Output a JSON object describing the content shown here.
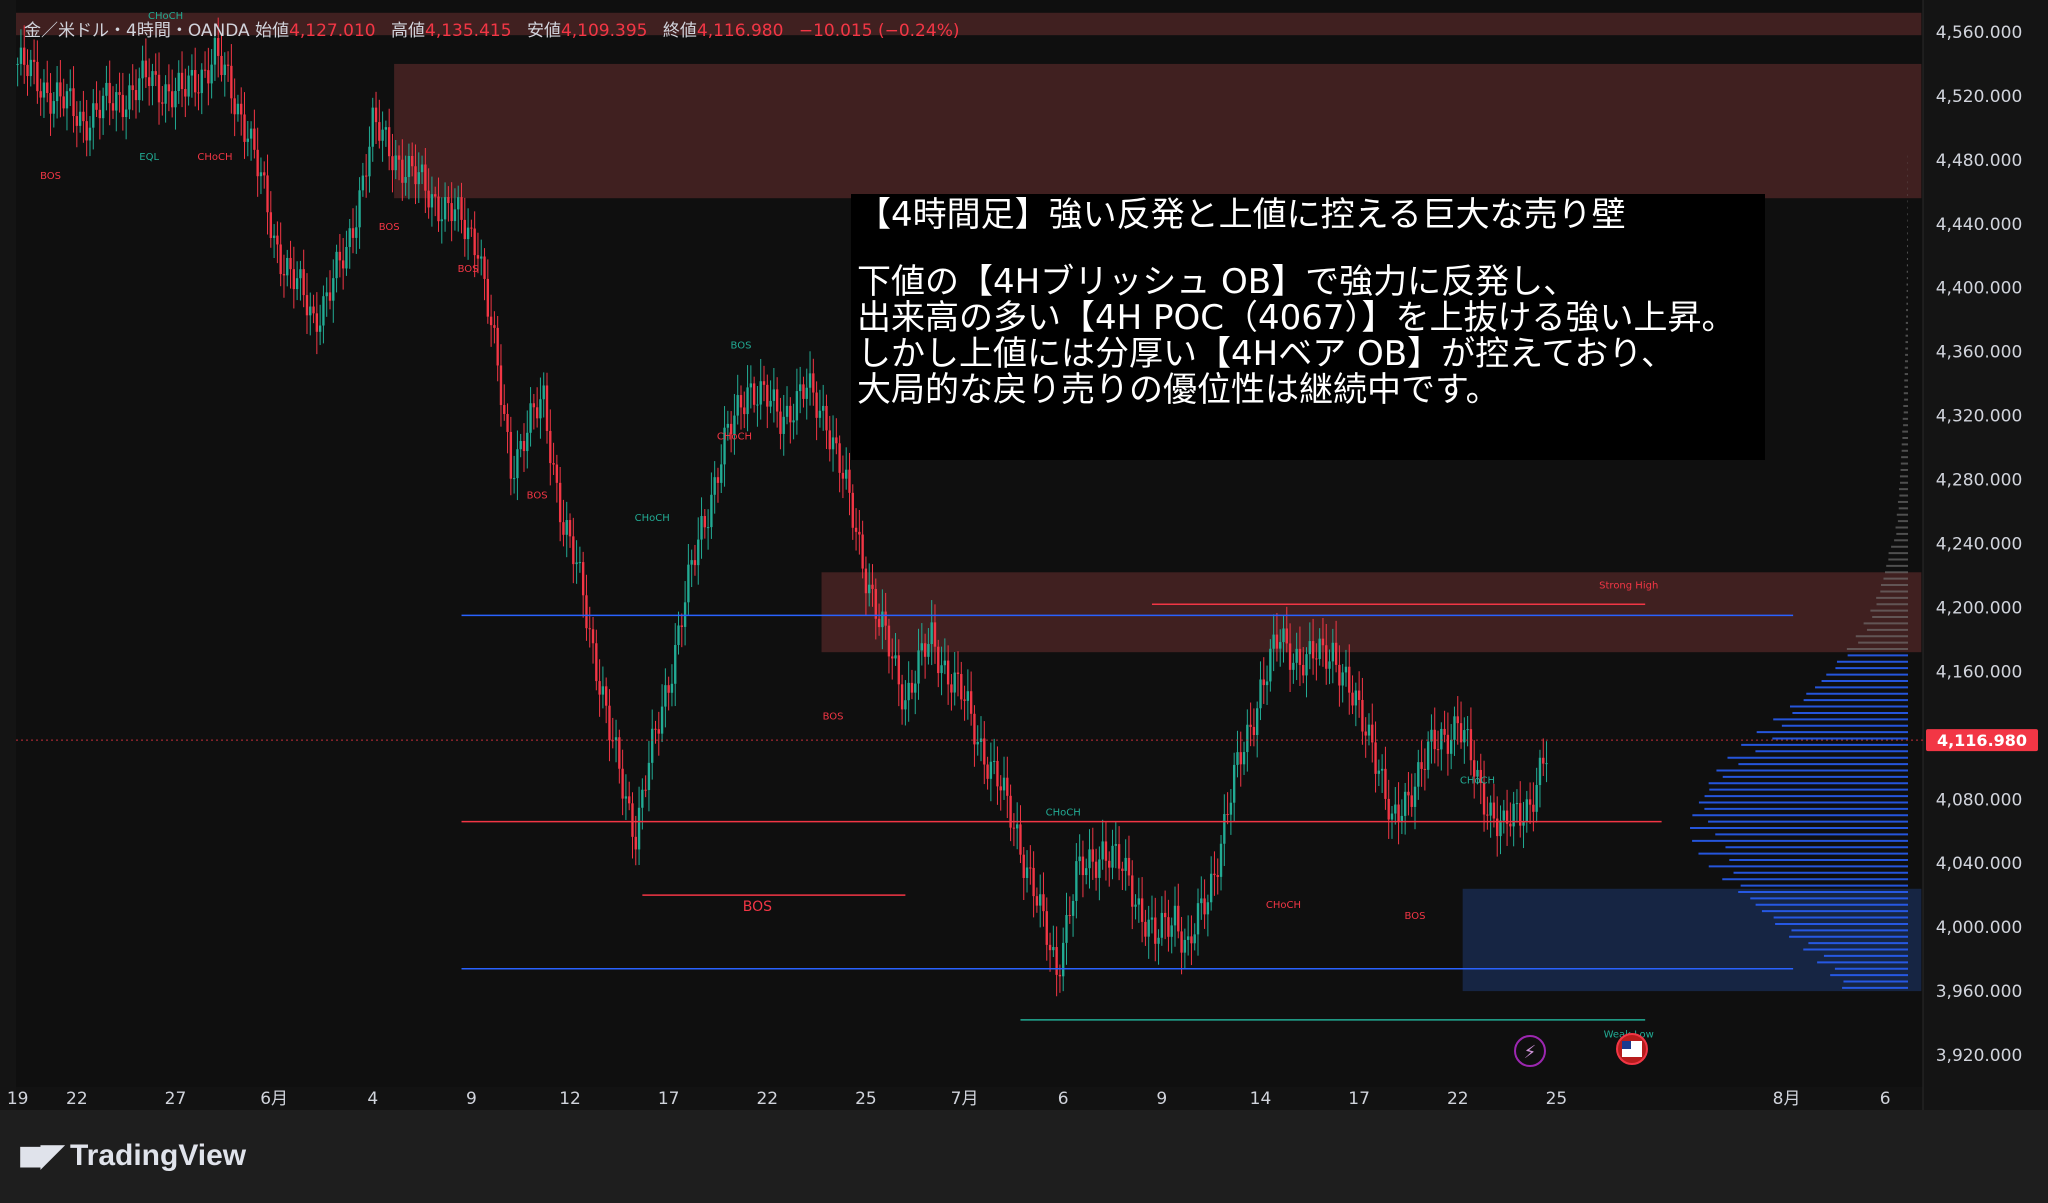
{
  "colors": {
    "up": "#22ab94",
    "down": "#f23645",
    "blue": "#2962ff",
    "bg": "#141414",
    "bear_zone": "#5a2a2a",
    "bull_zone": "#1a2d55",
    "price_label_bg": "#f23645"
  },
  "legend": {
    "symbol": "金／米ドル・4時間・OANDA",
    "open_label": "始値",
    "open": "4,127.010",
    "high_label": "高値",
    "high": "4,135.415",
    "low_label": "安値",
    "low": "4,109.395",
    "close_label": "終値",
    "close": "4,116.980",
    "change": "−10.015 (−0.24%)"
  },
  "annotation": {
    "title": "【4時間足】強い反発と上値に控える巨大な売り壁",
    "body": "下値の【4Hブリッシュ OB】で強力に反発し、\n出来高の多い【4H POC（4067）】を上抜ける強い上昇。\nしかし上値には分厚い【4Hベア OB】が控えており、\n大局的な戻り売りの優位性は継続中です。"
  },
  "footer": {
    "brand": "TradingView"
  },
  "chart_data": {
    "type": "candlestick",
    "title": "",
    "xlabel": "",
    "ylabel": "",
    "ylim": [
      3900,
      4580
    ],
    "y_ticks": [
      "4,560.000",
      "4,520.000",
      "4,480.000",
      "4,440.000",
      "4,400.000",
      "4,360.000",
      "4,320.000",
      "4,280.000",
      "4,240.000",
      "4,200.000",
      "4,160.000",
      "4,080.000",
      "4,040.000",
      "4,000.000",
      "3,960.000",
      "3,920.000"
    ],
    "y_tick_values": [
      4560,
      4520,
      4480,
      4440,
      4400,
      4360,
      4320,
      4280,
      4240,
      4200,
      4160,
      4080,
      4040,
      4000,
      3960,
      3920
    ],
    "current_price_label": "4,116.980",
    "current_price": 4116.98,
    "x_tick_labels": [
      "19",
      "22",
      "27",
      "6月",
      "4",
      "9",
      "12",
      "17",
      "22",
      "25",
      "7月",
      "6",
      "9",
      "14",
      "17",
      "22",
      "25",
      "8月",
      "6"
    ],
    "x_tick_idx": [
      0,
      18,
      48,
      78,
      108,
      138,
      168,
      198,
      228,
      258,
      288,
      318,
      348,
      378,
      408,
      438,
      468,
      538,
      568
    ],
    "n_slots": 580,
    "last_candle_idx": 465,
    "price_path": [
      [
        0,
        4540
      ],
      [
        20,
        4505
      ],
      [
        40,
        4530
      ],
      [
        50,
        4520
      ],
      [
        60,
        4545
      ],
      [
        70,
        4500
      ],
      [
        78,
        4430
      ],
      [
        90,
        4380
      ],
      [
        100,
        4420
      ],
      [
        108,
        4500
      ],
      [
        120,
        4470
      ],
      [
        140,
        4430
      ],
      [
        150,
        4290
      ],
      [
        160,
        4330
      ],
      [
        166,
        4250
      ],
      [
        172,
        4210
      ],
      [
        180,
        4120
      ],
      [
        188,
        4060
      ],
      [
        192,
        4100
      ],
      [
        200,
        4175
      ],
      [
        208,
        4250
      ],
      [
        215,
        4300
      ],
      [
        222,
        4340
      ],
      [
        232,
        4320
      ],
      [
        240,
        4335
      ],
      [
        246,
        4320
      ],
      [
        256,
        4240
      ],
      [
        262,
        4190
      ],
      [
        270,
        4145
      ],
      [
        278,
        4180
      ],
      [
        288,
        4140
      ],
      [
        296,
        4100
      ],
      [
        304,
        4060
      ],
      [
        312,
        4000
      ],
      [
        316,
        3975
      ],
      [
        322,
        4030
      ],
      [
        330,
        4050
      ],
      [
        338,
        4030
      ],
      [
        346,
        3990
      ],
      [
        352,
        4010
      ],
      [
        356,
        3985
      ],
      [
        362,
        4020
      ],
      [
        370,
        4090
      ],
      [
        378,
        4150
      ],
      [
        384,
        4180
      ],
      [
        392,
        4165
      ],
      [
        400,
        4175
      ],
      [
        406,
        4140
      ],
      [
        412,
        4120
      ],
      [
        418,
        4060
      ],
      [
        424,
        4090
      ],
      [
        430,
        4110
      ],
      [
        438,
        4130
      ],
      [
        444,
        4090
      ],
      [
        452,
        4060
      ],
      [
        460,
        4080
      ],
      [
        466,
        4110
      ],
      [
        470,
        4090
      ],
      [
        478,
        4040
      ],
      [
        486,
        4060
      ],
      [
        494,
        4060
      ],
      [
        502,
        4020
      ],
      [
        510,
        3985
      ],
      [
        516,
        3990
      ],
      [
        522,
        4010
      ],
      [
        528,
        4000
      ],
      [
        534,
        4040
      ],
      [
        540,
        4070
      ],
      [
        546,
        4105
      ],
      [
        550,
        4120
      ]
    ],
    "lines": [
      {
        "name": "h_4195",
        "kind": "blue",
        "y": 4195,
        "x0": 135,
        "x1": 540
      },
      {
        "name": "h_4066",
        "kind": "red",
        "y": 4066,
        "x0": 135,
        "x1": 500
      },
      {
        "name": "h_3974",
        "kind": "blue",
        "y": 3974,
        "x0": 135,
        "x1": 540
      },
      {
        "name": "h_4020",
        "kind": "red",
        "y": 4020,
        "x0": 190,
        "x1": 270
      },
      {
        "name": "h_4202",
        "kind": "red",
        "y": 4202,
        "x0": 345,
        "x1": 495
      },
      {
        "name": "h_3942",
        "kind": "green",
        "y": 3942,
        "x0": 305,
        "x1": 495
      }
    ],
    "zones": [
      {
        "name": "top_zone",
        "kind": "bear",
        "y_top": 4572,
        "y_bottom": 4558,
        "x0": 0,
        "x1": 580
      },
      {
        "name": "bear_ob_upper",
        "kind": "bear",
        "y_top": 4540,
        "y_bottom": 4456,
        "x0": 115,
        "x1": 580
      },
      {
        "name": "bear_ob_4h",
        "kind": "bear",
        "y_top": 4222,
        "y_bottom": 4172,
        "x0": 245,
        "x1": 580
      },
      {
        "name": "bull_ob_4h",
        "kind": "bull",
        "y_top": 4024,
        "y_bottom": 3960,
        "x0": 440,
        "x1": 580
      }
    ],
    "labels": [
      {
        "text": "BOS",
        "x": 225,
        "y": 4010,
        "kind": "red"
      },
      {
        "text": "Strong High",
        "x": 490,
        "y": 4212,
        "kind": "red"
      },
      {
        "text": "Weak Low",
        "x": 490,
        "y": 3931,
        "kind": "green"
      },
      {
        "text": "CHoCH",
        "x": 318,
        "y": 4070,
        "kind": "green"
      },
      {
        "text": "CHoCH",
        "x": 385,
        "y": 4012,
        "kind": "red"
      },
      {
        "text": "BOS",
        "x": 425,
        "y": 4005,
        "kind": "red"
      },
      {
        "text": "CHoCH",
        "x": 444,
        "y": 4090,
        "kind": "green"
      },
      {
        "text": "BOS",
        "x": 248,
        "y": 4130,
        "kind": "red"
      },
      {
        "text": "CHoCH",
        "x": 218,
        "y": 4305,
        "kind": "red"
      },
      {
        "text": "BOS",
        "x": 220,
        "y": 4362,
        "kind": "green"
      },
      {
        "text": "CHoCH",
        "x": 193,
        "y": 4254,
        "kind": "green"
      },
      {
        "text": "BOS",
        "x": 158,
        "y": 4268,
        "kind": "red"
      },
      {
        "text": "BOS",
        "x": 113,
        "y": 4436,
        "kind": "red"
      },
      {
        "text": "BOS",
        "x": 137,
        "y": 4410,
        "kind": "red"
      },
      {
        "text": "CHoCH",
        "x": 60,
        "y": 4480,
        "kind": "red"
      },
      {
        "text": "EQL",
        "x": 40,
        "y": 4480,
        "kind": "green"
      },
      {
        "text": "BOS",
        "x": 10,
        "y": 4468,
        "kind": "red"
      },
      {
        "text": "CHoCH",
        "x": 45,
        "y": 4568,
        "kind": "green"
      }
    ],
    "volume_profile": {
      "price_min": 3962,
      "price_max": 4482,
      "step": 4,
      "poc": 4066,
      "max_len": 220,
      "blue_below": 4172,
      "value_area_low": 3980,
      "value_area_high": 4170
    }
  }
}
